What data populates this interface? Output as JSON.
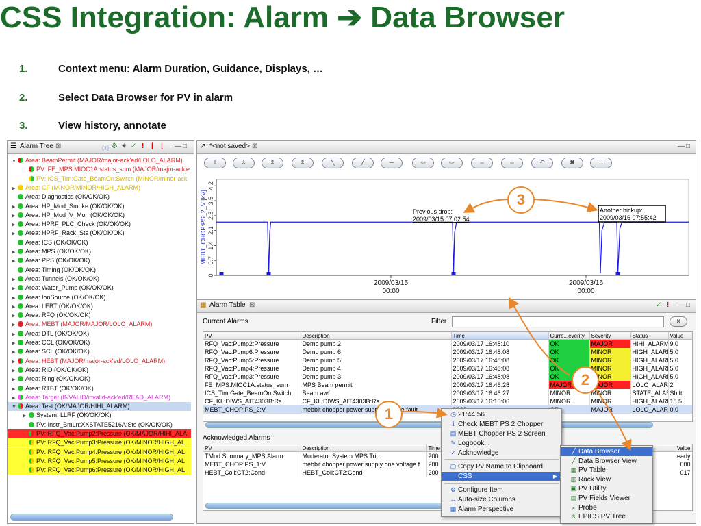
{
  "slide": {
    "title": "CSS Integration: Alarm ➔ Data Browser",
    "bullets": [
      {
        "num": "1.",
        "text": "Context menu: Alarm Duration, Guidance, Displays, …"
      },
      {
        "num": "2.",
        "text": "Select Data Browser for PV in alarm"
      },
      {
        "num": "3.",
        "text": "View history, annotate"
      }
    ]
  },
  "alarm_tree": {
    "tab_label": "Alarm Tree",
    "rows": [
      {
        "text": "Area: BeamPermit (MAJOR/major-ack'ed/LOLO_ALARM)",
        "indent": 0,
        "arrow": "▼",
        "dot": "half-red",
        "color": "#d9232a",
        "bg": ""
      },
      {
        "text": "PV: FE_MPS:MIOC1A:status_sum (MAJOR/major-ack'e",
        "indent": 2,
        "arrow": "",
        "dot": "half-red",
        "color": "#d9232a",
        "bg": ""
      },
      {
        "text": "PV: ICS_Tim:Gate_BeamOn:Switch (MINOR/minor-ack",
        "indent": 2,
        "arrow": "",
        "dot": "half-yellow",
        "color": "#d4b800",
        "bg": ""
      },
      {
        "text": "Area: CF (MINOR/MINOR/HIGH_ALARM)",
        "indent": 0,
        "arrow": "▶",
        "dot": "yellow",
        "color": "#d4b800",
        "bg": ""
      },
      {
        "text": "Area: Diagnostics (OK/OK/OK)",
        "indent": 0,
        "arrow": "",
        "dot": "green",
        "color": "#111",
        "bg": ""
      },
      {
        "text": "Area: HP_Mod_Smoke (OK/OK/OK)",
        "indent": 0,
        "arrow": "▶",
        "dot": "green",
        "color": "#111",
        "bg": ""
      },
      {
        "text": "Area: HP_Mod_V_Mon (OK/OK/OK)",
        "indent": 0,
        "arrow": "▶",
        "dot": "green",
        "color": "#111",
        "bg": ""
      },
      {
        "text": "Area: HPRF_PLC_Check (OK/OK/OK)",
        "indent": 0,
        "arrow": "▶",
        "dot": "green",
        "color": "#111",
        "bg": ""
      },
      {
        "text": "Area: HPRF_Rack_Sts (OK/OK/OK)",
        "indent": 0,
        "arrow": "▶",
        "dot": "green",
        "color": "#111",
        "bg": ""
      },
      {
        "text": "Area: ICS (OK/OK/OK)",
        "indent": 0,
        "arrow": "",
        "dot": "green",
        "color": "#111",
        "bg": ""
      },
      {
        "text": "Area: MPS (OK/OK/OK)",
        "indent": 0,
        "arrow": "▶",
        "dot": "green",
        "color": "#111",
        "bg": ""
      },
      {
        "text": "Area: PPS (OK/OK/OK)",
        "indent": 0,
        "arrow": "▶",
        "dot": "green",
        "color": "#111",
        "bg": ""
      },
      {
        "text": "Area: Timing (OK/OK/OK)",
        "indent": 0,
        "arrow": "",
        "dot": "green",
        "color": "#111",
        "bg": ""
      },
      {
        "text": "Area: Tunnels (OK/OK/OK)",
        "indent": 0,
        "arrow": "▶",
        "dot": "green",
        "color": "#111",
        "bg": ""
      },
      {
        "text": "Area: Water_Pump (OK/OK/OK)",
        "indent": 0,
        "arrow": "▶",
        "dot": "green",
        "color": "#111",
        "bg": ""
      },
      {
        "text": "Area: IonSource (OK/OK/OK)",
        "indent": 0,
        "arrow": "▶",
        "dot": "green",
        "color": "#111",
        "bg": ""
      },
      {
        "text": "Area: LEBT (OK/OK/OK)",
        "indent": 0,
        "arrow": "▶",
        "dot": "green",
        "color": "#111",
        "bg": ""
      },
      {
        "text": "Area: RFQ (OK/OK/OK)",
        "indent": 0,
        "arrow": "▶",
        "dot": "green",
        "color": "#111",
        "bg": ""
      },
      {
        "text": "Area: MEBT (MAJOR/MAJOR/LOLO_ALARM)",
        "indent": 0,
        "arrow": "▶",
        "dot": "red",
        "color": "#d9232a",
        "bg": ""
      },
      {
        "text": "Area: DTL (OK/OK/OK)",
        "indent": 0,
        "arrow": "▶",
        "dot": "green",
        "color": "#111",
        "bg": ""
      },
      {
        "text": "Area: CCL (OK/OK/OK)",
        "indent": 0,
        "arrow": "▶",
        "dot": "green",
        "color": "#111",
        "bg": ""
      },
      {
        "text": "Area: SCL (OK/OK/OK)",
        "indent": 0,
        "arrow": "▶",
        "dot": "green",
        "color": "#111",
        "bg": ""
      },
      {
        "text": "Area: HEBT (MAJOR/major-ack'ed/LOLO_ALARM)",
        "indent": 0,
        "arrow": "▶",
        "dot": "half-red",
        "color": "#d9232a",
        "bg": ""
      },
      {
        "text": "Area: RID (OK/OK/OK)",
        "indent": 0,
        "arrow": "▶",
        "dot": "green",
        "color": "#111",
        "bg": ""
      },
      {
        "text": "Area: Ring (OK/OK/OK)",
        "indent": 0,
        "arrow": "▶",
        "dot": "green",
        "color": "#111",
        "bg": ""
      },
      {
        "text": "Area: RTBT (OK/OK/OK)",
        "indent": 0,
        "arrow": "▶",
        "dot": "green",
        "color": "#111",
        "bg": ""
      },
      {
        "text": "Area: Target (INVALID/invalid-ack'ed/READ_ALARM)",
        "indent": 0,
        "arrow": "▶",
        "dot": "half-magenta",
        "color": "#d63ad6",
        "bg": ""
      },
      {
        "text": "Area: Test (OK/MAJOR/HIHI_ALARM)",
        "indent": 0,
        "arrow": "▼",
        "dot": "half-green-red",
        "color": "#111",
        "bg": "#c6d9f0"
      },
      {
        "text": "System: LLRF (OK/OK/OK)",
        "indent": 2,
        "arrow": "▶",
        "dot": "green",
        "color": "#111",
        "bg": ""
      },
      {
        "text": "PV: Instr_BmLn:XXSTATE5216A:Sts (OK/OK/OK)",
        "indent": 2,
        "arrow": "",
        "dot": "green",
        "color": "#111",
        "bg": ""
      },
      {
        "text": "PV: RFQ_Vac:Pump2:Pressure (OK/MAJOR/HIHI_ALA",
        "indent": 2,
        "arrow": "",
        "dot": "half-green-red",
        "color": "#111",
        "bg": "#ff2b2b"
      },
      {
        "text": "PV: RFQ_Vac:Pump3:Pressure (OK/MINOR/HIGH_AL",
        "indent": 2,
        "arrow": "",
        "dot": "half-green-yellow",
        "color": "#111",
        "bg": "#ffff33"
      },
      {
        "text": "PV: RFQ_Vac:Pump4:Pressure (OK/MINOR/HIGH_AL",
        "indent": 2,
        "arrow": "",
        "dot": "half-green-yellow",
        "color": "#111",
        "bg": "#ffff33"
      },
      {
        "text": "PV: RFQ_Vac:Pump5:Pressure (OK/MINOR/HIGH_AL",
        "indent": 2,
        "arrow": "",
        "dot": "half-green-yellow",
        "color": "#111",
        "bg": "#ffff33"
      },
      {
        "text": "PV: RFQ_Vac:Pump6:Pressure (OK/MINOR/HIGH_AL",
        "indent": 2,
        "arrow": "",
        "dot": "half-green-yellow",
        "color": "#111",
        "bg": "#ffff33"
      }
    ]
  },
  "data_browser": {
    "tab_label": "*<not saved>",
    "toolbar_buttons": [
      "⇧",
      "⇩",
      "⇕",
      "⇕",
      "╲",
      "╱",
      "─",
      "⇦",
      "⇨",
      "⇔",
      "⇔",
      "↶",
      "✖",
      "..."
    ],
    "annotations": [
      {
        "line1": "Previous drop:",
        "line2": "2009/03/15 07:02:54"
      },
      {
        "line1": "Another hickup:",
        "line2": "2009/03/16 07:55:42"
      }
    ]
  },
  "chart_data": {
    "type": "line",
    "ylabel": "MEBT_CHOP:PS_2_V [kV]",
    "yticks": [
      "0",
      "0.7",
      "1.4",
      "2.1",
      "2.8",
      "3.5",
      "4.2"
    ],
    "ylim": [
      0,
      4.5
    ],
    "xticks": [
      {
        "line1": "2009/03/15",
        "line2": "00:00"
      },
      {
        "line1": "2009/03/16",
        "line2": "00:00"
      }
    ],
    "series": [
      {
        "color": "#1c1cdc",
        "points": [
          [
            0.0,
            2.5
          ],
          [
            0.5,
            2.5
          ],
          [
            0.5,
            2.3
          ],
          [
            0.51,
            0.0
          ],
          [
            0.52,
            2.0
          ],
          [
            0.53,
            2.5
          ],
          [
            2.3,
            2.5
          ],
          [
            2.31,
            0.1
          ],
          [
            2.32,
            2.0
          ],
          [
            2.34,
            2.5
          ],
          [
            3.73,
            2.5
          ],
          [
            3.74,
            0.1
          ],
          [
            3.755,
            2.1
          ],
          [
            3.78,
            2.5
          ],
          [
            3.9,
            2.5
          ],
          [
            3.91,
            0.05
          ],
          [
            3.93,
            2.2
          ],
          [
            3.95,
            2.5
          ],
          [
            4.6,
            2.5
          ]
        ]
      }
    ],
    "grid": false
  },
  "alarm_table": {
    "tab_label": "Alarm Table",
    "current_label": "Current Alarms",
    "filter_label": "Filter",
    "filter_value": "",
    "clear_label": "×",
    "columns": [
      "PV",
      "Description",
      "Time",
      "Curre...everity",
      "Severity",
      "Status",
      "Value"
    ],
    "rows": [
      {
        "pv": "RFQ_Vac:Pump2:Pressure",
        "desc": "Demo pump 2",
        "time": "2009/03/17 16:48:10",
        "cur": "OK",
        "sev": "MAJOR",
        "status": "HIHI_ALARM",
        "value": "9.0",
        "curColor": "#20d040",
        "sevColor": "#ff2020"
      },
      {
        "pv": "RFQ_Vac:Pump6:Pressure",
        "desc": "Demo pump 6",
        "time": "2009/03/17 16:48:08",
        "cur": "OK",
        "sev": "MINOR",
        "status": "HIGH_ALARM",
        "value": "5.0",
        "curColor": "#20d040",
        "sevColor": "#f4f030"
      },
      {
        "pv": "RFQ_Vac:Pump5:Pressure",
        "desc": "Demo pump 5",
        "time": "2009/03/17 16:48:08",
        "cur": "OK",
        "sev": "MINOR",
        "status": "HIGH_ALARM",
        "value": "5.0",
        "curColor": "#20d040",
        "sevColor": "#f4f030"
      },
      {
        "pv": "RFQ_Vac:Pump4:Pressure",
        "desc": "Demo pump 4",
        "time": "2009/03/17 16:48:08",
        "cur": "OK",
        "sev": "MINOR",
        "status": "HIGH_ALARM",
        "value": "5.0",
        "curColor": "#20d040",
        "sevColor": "#f4f030"
      },
      {
        "pv": "RFQ_Vac:Pump3:Pressure",
        "desc": "Demo pump 3",
        "time": "2009/03/17 16:48:08",
        "cur": "OK",
        "sev": "MINOR",
        "status": "HIGH_ALARM",
        "value": "5.0",
        "curColor": "#20d040",
        "sevColor": "#f4f030"
      },
      {
        "pv": "FE_MPS:MIOC1A:status_sum",
        "desc": "MPS Beam permit",
        "time": "2009/03/17 16:46:28",
        "cur": "MAJOR",
        "sev": "MAJOR",
        "status": "LOLO_ALARM",
        "value": "2",
        "curColor": "#ff2020",
        "sevColor": "#ff2020"
      },
      {
        "pv": "ICS_Tim:Gate_BeamOn:Switch",
        "desc": "Beam awf",
        "time": "2009/03/17 16:46:27",
        "cur": "MINOR",
        "sev": "MINOR",
        "status": "STATE_ALAR",
        "value": "Shift",
        "curColor": "",
        "sevColor": ""
      },
      {
        "pv": "CF_KL:DIWS_AIT4303B:Rs",
        "desc": "CF_KL:DIWS_AIT4303B:Rs",
        "time": "2009/03/17 16:10:06",
        "cur": "MINOR",
        "sev": "MINOR",
        "status": "HIGH_ALARM",
        "value": "18.5",
        "curColor": "",
        "sevColor": ""
      },
      {
        "pv": "MEBT_CHOP:PS_2:V",
        "desc": "mebbit chopper power supply voltage fault",
        "time": "2009",
        "cur": "OR",
        "sev": "MAJOR",
        "status": "LOLO_ALARM",
        "value": "0.0",
        "curColor": "",
        "sevColor": "",
        "selected": true
      }
    ],
    "ack_label": "Acknowledged Alarms",
    "ack_columns": [
      "PV",
      "Description",
      "Time",
      "Value"
    ],
    "ack_rows": [
      {
        "pv": "TMod:Summary_MPS:Alarm",
        "desc": "Moderator System MPS Trip",
        "time": "200",
        "value": "eady"
      },
      {
        "pv": "MEBT_CHOP:PS_1:V",
        "desc": "mebbit chopper power supply one voltage f",
        "time": "200",
        "value": "000"
      },
      {
        "pv": "HEBT_Coll:CT2:Cond",
        "desc": "HEBT_Coll:CT2:Cond",
        "time": "200",
        "value": "017"
      }
    ]
  },
  "context_menu": {
    "items": [
      {
        "icon": "◷",
        "label": "21:44:56",
        "icon_name": "clock-icon"
      },
      {
        "icon": "ℹ",
        "label": "Check MEBT PS 2 Chopper",
        "icon_name": "info-icon"
      },
      {
        "icon": "▤",
        "label": "MEBT Chopper PS 2 Screen",
        "icon_name": "screen-icon"
      },
      {
        "icon": "✎",
        "label": "Logbook...",
        "icon_name": "pencil-icon"
      },
      {
        "icon": "✓",
        "label": "Acknowledge",
        "icon_name": "check-icon"
      },
      {
        "icon": "▢",
        "label": "Copy Pv Name to Clipboard",
        "icon_name": "clipboard-icon"
      },
      {
        "icon": "",
        "label": "CSS",
        "icon_name": "",
        "submenu": "▶"
      },
      {
        "icon": "⚙",
        "label": "Configure Item",
        "icon_name": "configure-icon"
      },
      {
        "icon": "↔",
        "label": "Auto-size Columns",
        "icon_name": "resize-icon"
      },
      {
        "icon": "▦",
        "label": "Alarm Perspective",
        "icon_name": "perspective-icon"
      }
    ]
  },
  "css_submenu": {
    "items": [
      {
        "icon": "╱",
        "label": "Data Browser",
        "icon_name": "chart-icon"
      },
      {
        "icon": "╱",
        "label": "Data Browser View",
        "icon_name": "chart-icon"
      },
      {
        "icon": "▦",
        "label": "PV Table",
        "icon_name": "table-icon"
      },
      {
        "icon": "▥",
        "label": "Rack View",
        "icon_name": "rack-icon"
      },
      {
        "icon": "▣",
        "label": "PV Utility",
        "icon_name": "utility-icon"
      },
      {
        "icon": "▤",
        "label": "PV Fields Viewer",
        "icon_name": "fields-icon"
      },
      {
        "icon": "⌕",
        "label": "Probe",
        "icon_name": "probe-icon"
      },
      {
        "icon": "š",
        "label": "EPICS PV Tree",
        "icon_name": "tree-icon"
      }
    ]
  },
  "callouts": [
    "1",
    "2",
    "3"
  ],
  "colors": {
    "title_green": "#1c6b2a",
    "callout_orange": "#e9872a",
    "selection_blue": "#3d6fcf"
  }
}
